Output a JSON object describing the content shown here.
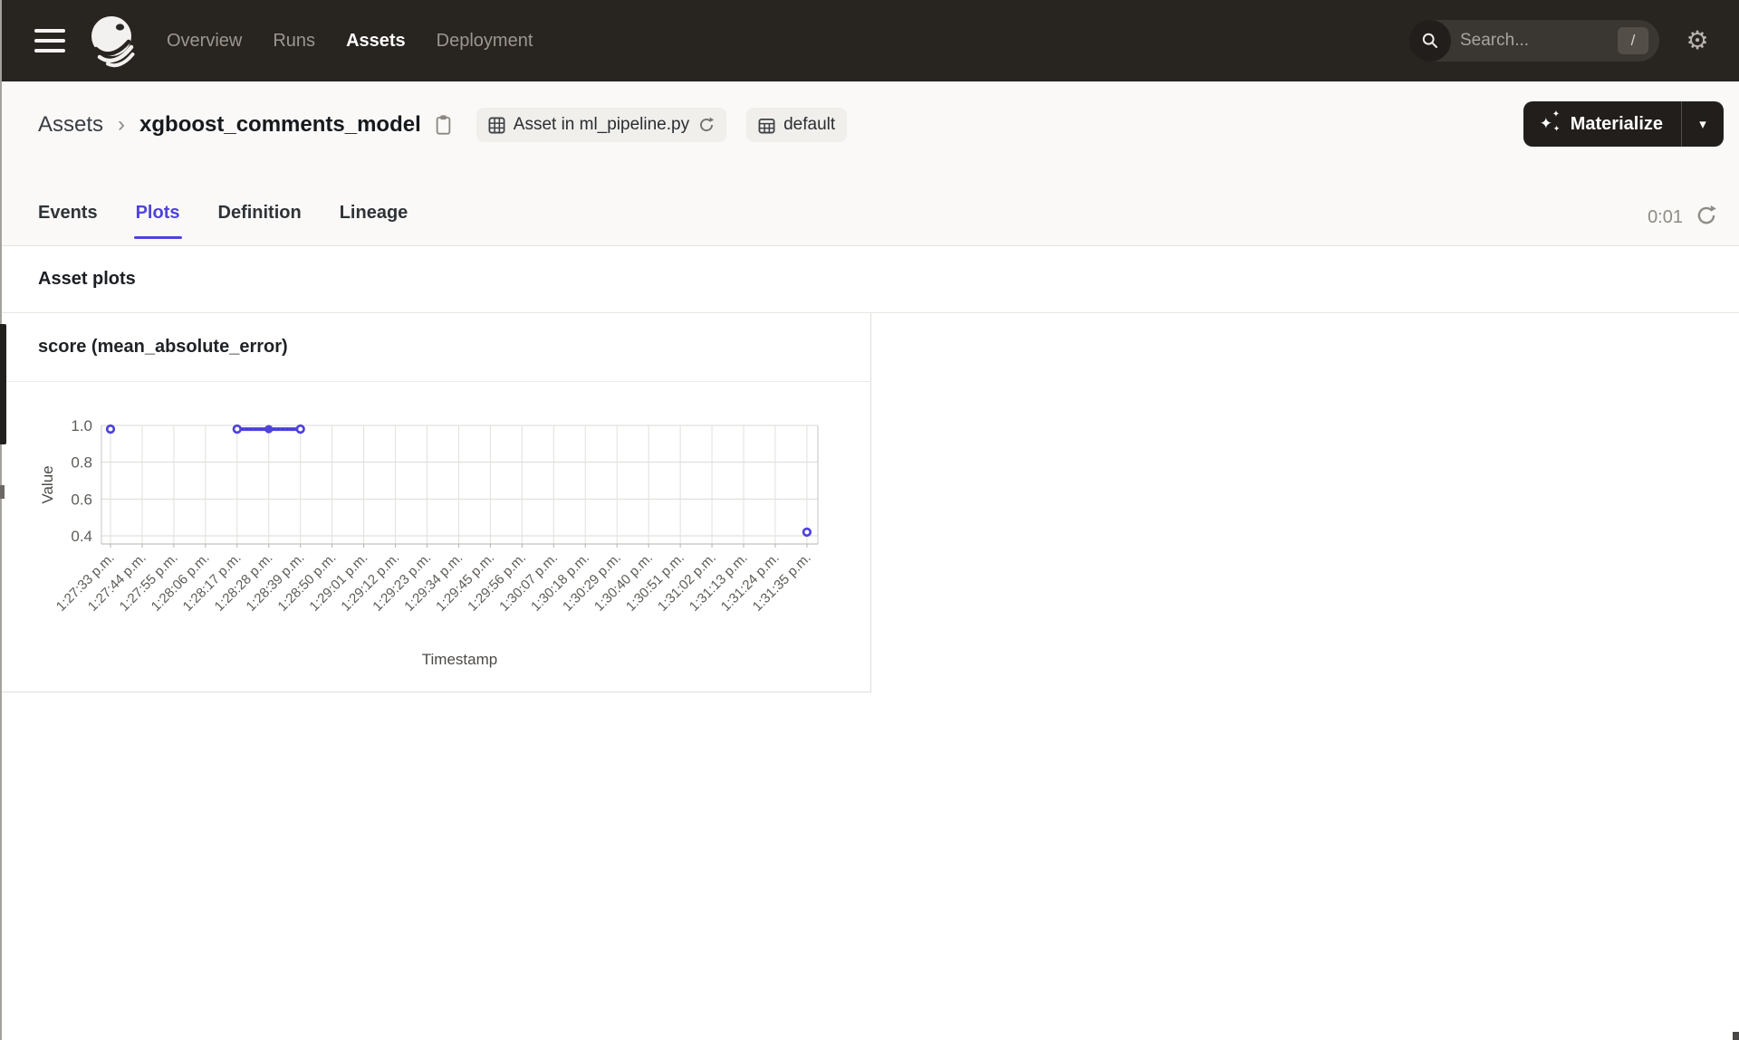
{
  "colors": {
    "accent": "#4f43dd",
    "series": "#4f43dd",
    "nav_bg": "#282420",
    "button_bg": "#211e1b"
  },
  "nav": {
    "items": [
      {
        "label": "Overview",
        "active": false
      },
      {
        "label": "Runs",
        "active": false
      },
      {
        "label": "Assets",
        "active": true
      },
      {
        "label": "Deployment",
        "active": false
      }
    ],
    "search": {
      "placeholder": "Search...",
      "shortcut": "/"
    }
  },
  "header": {
    "breadcrumb": {
      "root": "Assets",
      "separator": "›",
      "title": "xgboost_comments_model"
    },
    "badges": [
      {
        "label": "Asset in ml_pipeline.py"
      },
      {
        "label": "default"
      }
    ],
    "materialize": {
      "label": "Materialize",
      "caret": "▾"
    }
  },
  "tabs": {
    "items": [
      {
        "label": "Events",
        "active": false
      },
      {
        "label": "Plots",
        "active": true
      },
      {
        "label": "Definition",
        "active": false
      },
      {
        "label": "Lineage",
        "active": false
      }
    ],
    "refresh_time": "0:01"
  },
  "section": {
    "title": "Asset plots"
  },
  "chart_card": {
    "title": "score (mean_absolute_error)"
  },
  "chart_data": {
    "type": "line",
    "title": "score (mean_absolute_error)",
    "xlabel": "Timestamp",
    "ylabel": "Value",
    "y_ticks": [
      1.0,
      0.8,
      0.6,
      0.4
    ],
    "ylim": [
      0.35,
      1.0
    ],
    "grid": true,
    "legend": false,
    "categories": [
      "1:27:33 p.m.",
      "1:27:44 p.m.",
      "1:27:55 p.m.",
      "1:28:06 p.m.",
      "1:28:17 p.m.",
      "1:28:28 p.m.",
      "1:28:39 p.m.",
      "1:28:50 p.m.",
      "1:29:01 p.m.",
      "1:29:12 p.m.",
      "1:29:23 p.m.",
      "1:29:34 p.m.",
      "1:29:45 p.m.",
      "1:29:56 p.m.",
      "1:30:07 p.m.",
      "1:30:18 p.m.",
      "1:30:29 p.m.",
      "1:30:40 p.m.",
      "1:30:51 p.m.",
      "1:31:02 p.m.",
      "1:31:13 p.m.",
      "1:31:24 p.m.",
      "1:31:35 p.m."
    ],
    "series": [
      {
        "name": "score (mean_absolute_error)",
        "color": "#4f43dd",
        "points": [
          {
            "x": "1:27:33 p.m.",
            "value": 0.98,
            "marker": "open"
          },
          {
            "x": "1:28:17 p.m.",
            "value": 0.98,
            "marker": "open"
          },
          {
            "x": "1:28:28 p.m.",
            "value": 0.98,
            "marker": "filled"
          },
          {
            "x": "1:28:39 p.m.",
            "value": 0.98,
            "marker": "open"
          },
          {
            "x": "1:31:35 p.m.",
            "value": 0.42,
            "marker": "open"
          }
        ],
        "connected_runs": [
          [
            "1:28:17 p.m.",
            "1:28:28 p.m.",
            "1:28:39 p.m."
          ]
        ]
      }
    ]
  }
}
